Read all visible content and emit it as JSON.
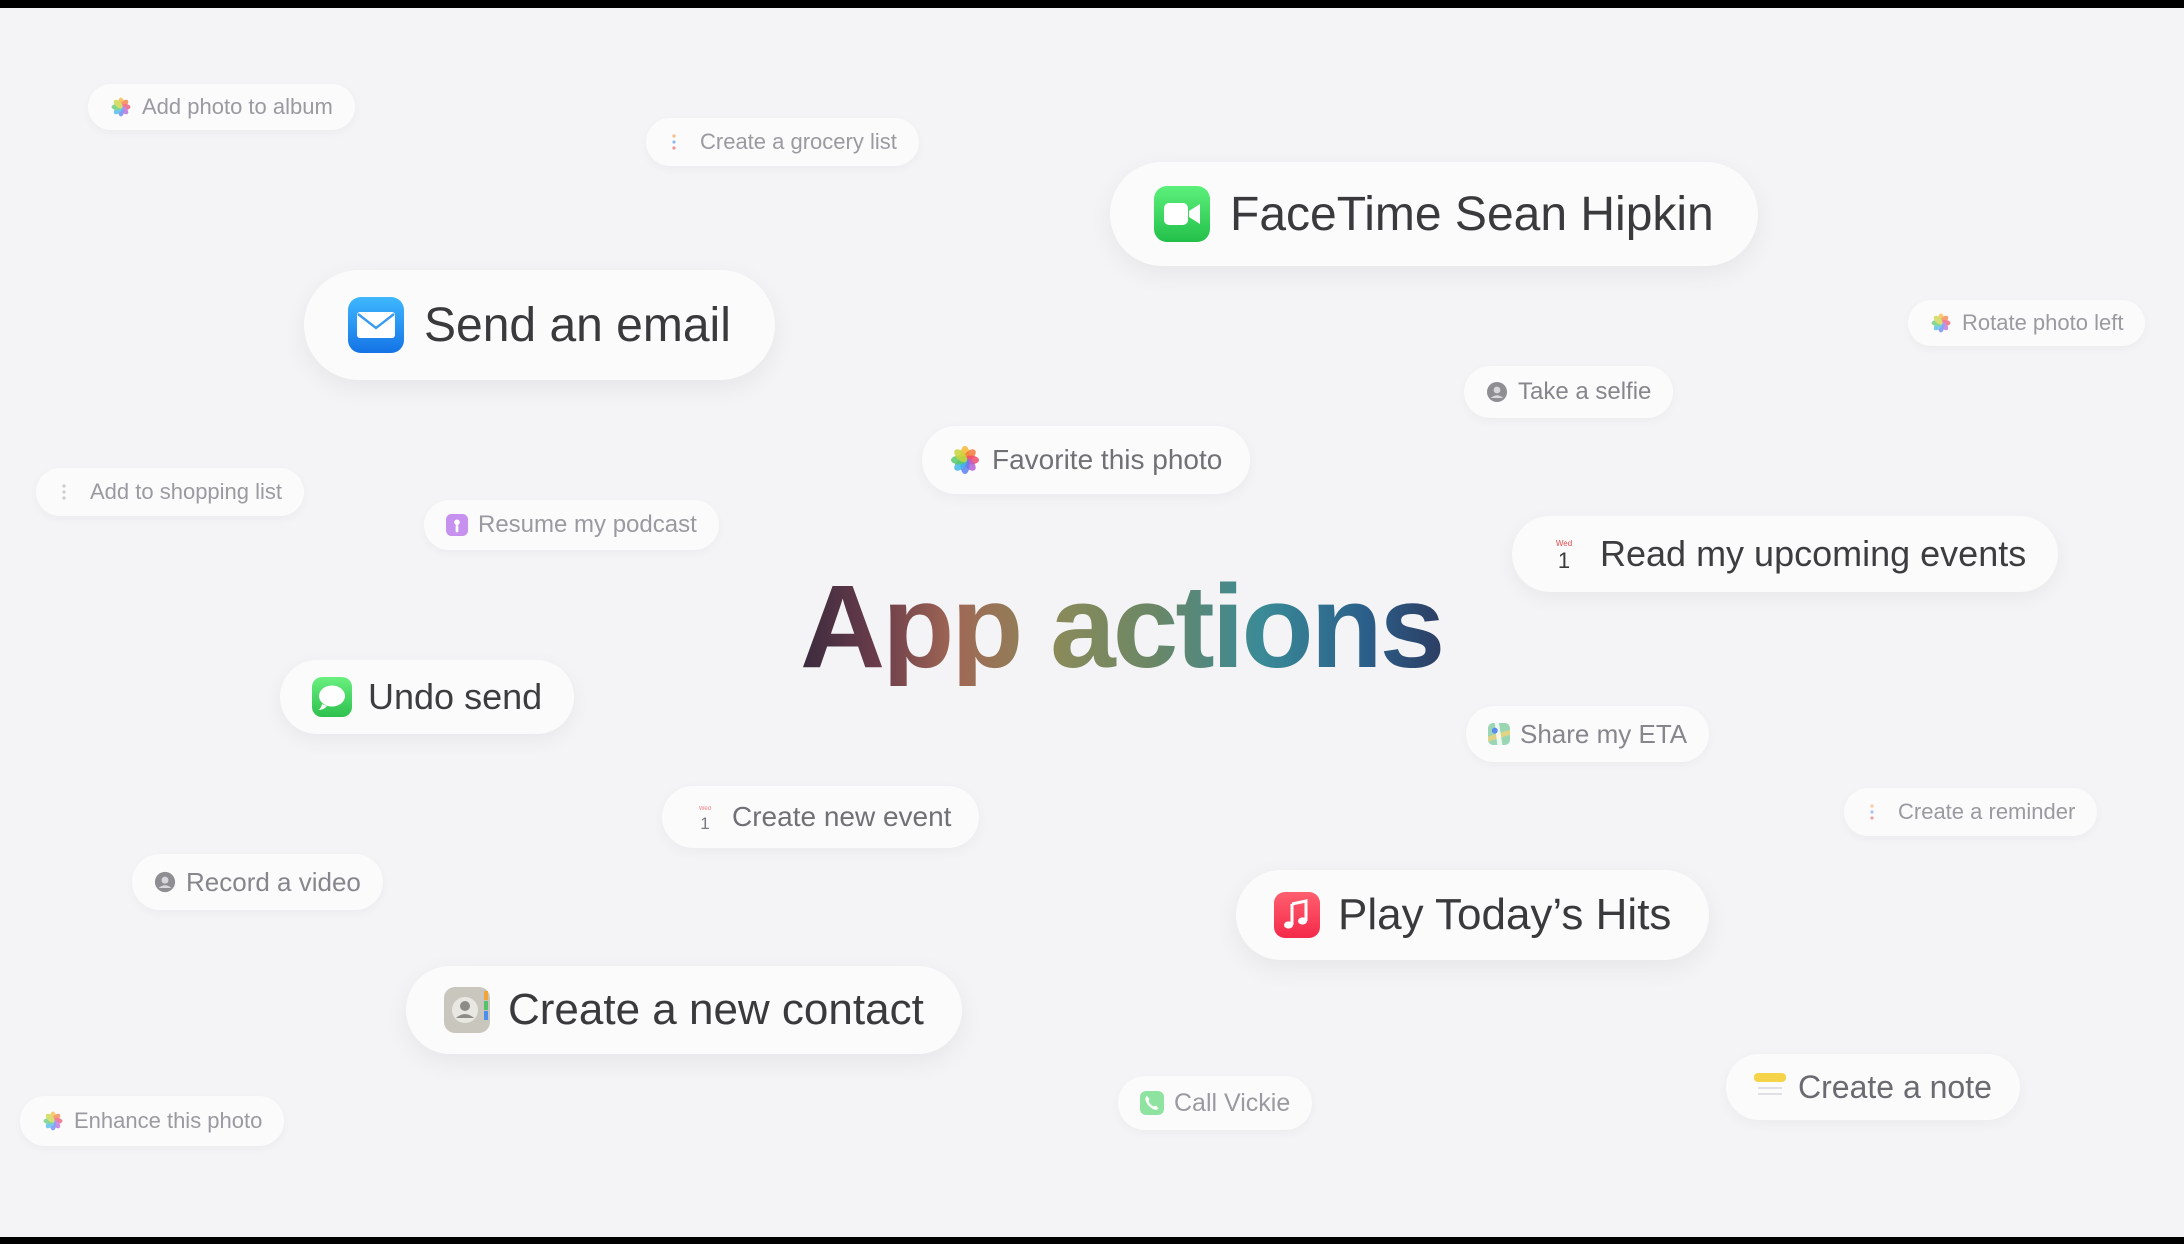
{
  "headline": "App actions",
  "actions": {
    "add_photo_to_album": "Add photo to album",
    "create_grocery_list": "Create a grocery list",
    "facetime": "FaceTime Sean Hipkin",
    "send_email": "Send an email",
    "rotate_photo_left": "Rotate photo left",
    "take_selfie": "Take a selfie",
    "favorite_photo": "Favorite this photo",
    "add_to_shopping_list": "Add to shopping list",
    "resume_podcast": "Resume my podcast",
    "read_upcoming_events": "Read my upcoming events",
    "undo_send": "Undo send",
    "share_eta": "Share my ETA",
    "create_reminder": "Create a reminder",
    "create_new_event": "Create new event",
    "record_video": "Record a video",
    "play_todays_hits": "Play Today’s Hits",
    "create_new_contact": "Create a new contact",
    "create_note": "Create a note",
    "call_vickie": "Call Vickie",
    "enhance_photo": "Enhance this photo"
  },
  "icons": {
    "photos": "photos-icon",
    "reminders": "reminders-icon",
    "facetime": "facetime-icon",
    "mail": "mail-icon",
    "camera": "camera-icon",
    "podcasts": "podcasts-icon",
    "calendar": "calendar-icon",
    "messages": "messages-icon",
    "maps": "maps-icon",
    "music": "music-icon",
    "contacts": "contacts-icon",
    "notes": "notes-icon",
    "phone": "phone-icon"
  },
  "calendar_icon": {
    "weekday": "Wed",
    "day": "1"
  },
  "colors": {
    "background": "#f4f4f6",
    "pill": "#fbfbfc",
    "facetime_green": "#34c759",
    "mail_blue": "#1e8cf0",
    "music_red": "#fa2d48",
    "podcasts_purple": "#b56ee8"
  }
}
